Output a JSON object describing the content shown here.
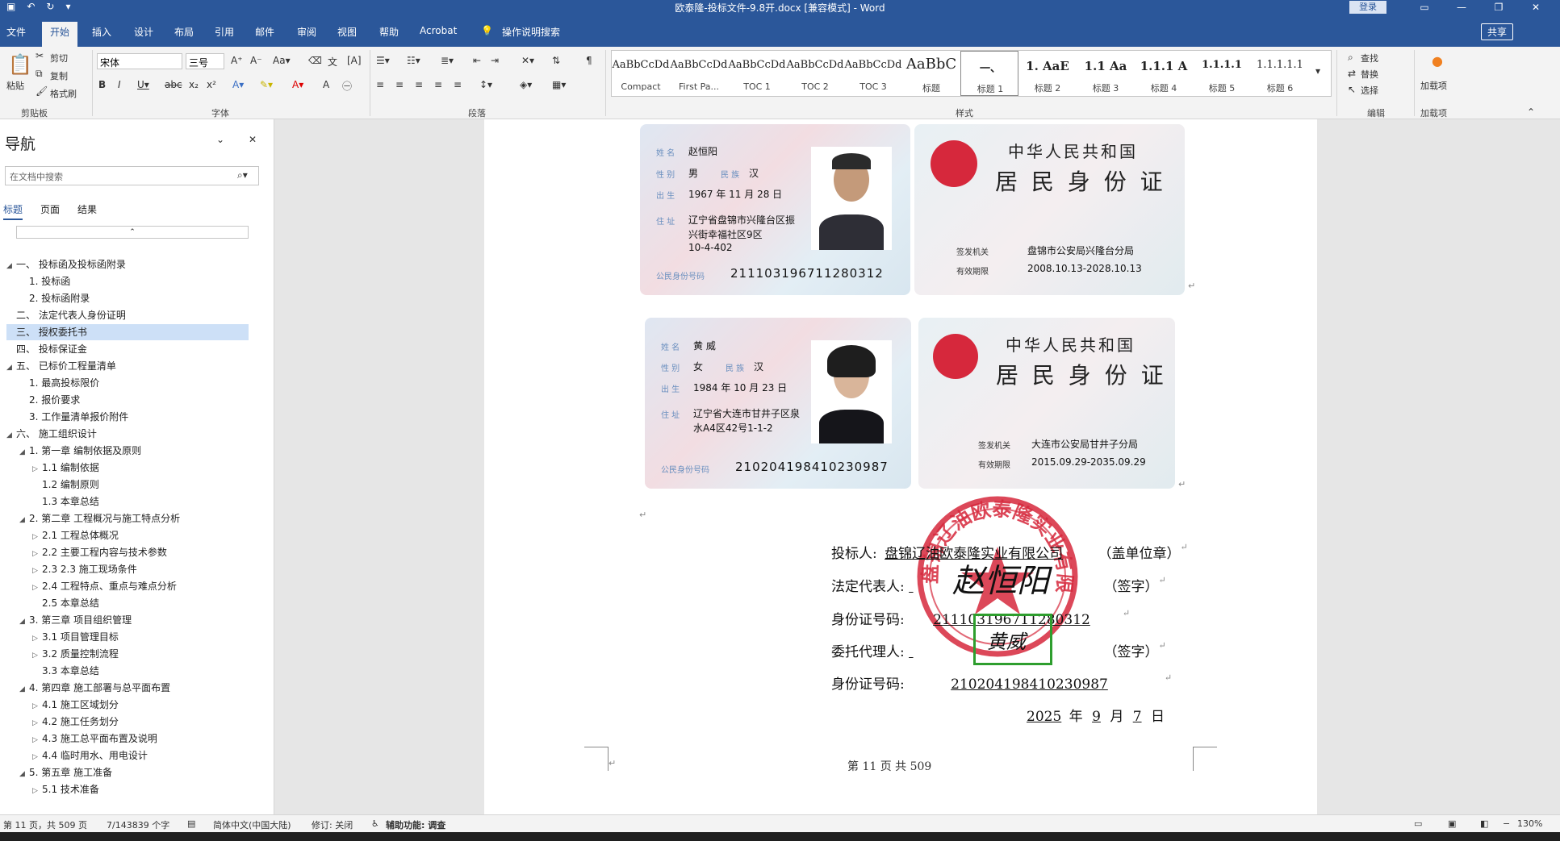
{
  "window": {
    "title": "欧泰隆-投标文件-9.8开.docx [兼容模式] - Word",
    "login": "登录",
    "share": "共享"
  },
  "tabs": [
    "文件",
    "开始",
    "插入",
    "设计",
    "布局",
    "引用",
    "邮件",
    "审阅",
    "视图",
    "帮助",
    "Acrobat",
    "操作说明搜索"
  ],
  "ribbon": {
    "clipboard": {
      "paste": "粘贴",
      "cut": "剪切",
      "copy": "复制",
      "format_painter": "格式刷",
      "label": "剪贴板"
    },
    "font": {
      "name": "宋体",
      "size": "三号",
      "label": "字体"
    },
    "paragraph": {
      "label": "段落"
    },
    "styles": {
      "label": "样式",
      "items": [
        {
          "sample": "AaBbCcDd",
          "name": "Compact"
        },
        {
          "sample": "AaBbCcDd",
          "name": "First Pa..."
        },
        {
          "sample": "AaBbCcDd",
          "name": "TOC 1"
        },
        {
          "sample": "AaBbCcDd",
          "name": "TOC 2"
        },
        {
          "sample": "AaBbCcDd",
          "name": "TOC 3"
        },
        {
          "sample": "AaBbC",
          "name": "标题"
        },
        {
          "sample": "一、",
          "name": "标题 1"
        },
        {
          "sample": "1. AaE",
          "name": "标题 2"
        },
        {
          "sample": "1.1 Aa",
          "name": "标题 3"
        },
        {
          "sample": "1.1.1 A",
          "name": "标题 4"
        },
        {
          "sample": "1.1.1.1",
          "name": "标题 5"
        },
        {
          "sample": "1.1.1.1.1",
          "name": "标题 6"
        }
      ]
    },
    "editing": {
      "find": "查找",
      "replace": "替换",
      "select": "选择",
      "label": "编辑"
    },
    "addins": {
      "addin": "加载项",
      "label": "加载项"
    }
  },
  "nav": {
    "title": "导航",
    "search_placeholder": "在文档中搜索",
    "tabs": [
      "标题",
      "页面",
      "结果"
    ],
    "items": [
      {
        "text": "一、 投标函及投标函附录",
        "level": 0,
        "toggle": "◢"
      },
      {
        "text": "1. 投标函",
        "level": 1,
        "toggle": ""
      },
      {
        "text": "2. 投标函附录",
        "level": 1,
        "toggle": ""
      },
      {
        "text": "二、 法定代表人身份证明",
        "level": 0,
        "toggle": ""
      },
      {
        "text": "三、 授权委托书",
        "level": 0,
        "toggle": "",
        "selected": true
      },
      {
        "text": "四、 投标保证金",
        "level": 0,
        "toggle": ""
      },
      {
        "text": "五、 已标价工程量清单",
        "level": 0,
        "toggle": "◢"
      },
      {
        "text": "1. 最高投标限价",
        "level": 1,
        "toggle": ""
      },
      {
        "text": "2. 报价要求",
        "level": 1,
        "toggle": ""
      },
      {
        "text": "3. 工作量清单报价附件",
        "level": 1,
        "toggle": ""
      },
      {
        "text": "六、 施工组织设计",
        "level": 0,
        "toggle": "◢"
      },
      {
        "text": "1. 第一章 编制依据及原则",
        "level": 1,
        "toggle": "◢"
      },
      {
        "text": "1.1 编制依据",
        "level": 2,
        "toggle": "▷"
      },
      {
        "text": "1.2 编制原则",
        "level": 2,
        "toggle": ""
      },
      {
        "text": "1.3 本章总结",
        "level": 2,
        "toggle": ""
      },
      {
        "text": "2. 第二章 工程概况与施工特点分析",
        "level": 1,
        "toggle": "◢"
      },
      {
        "text": "2.1 工程总体概况",
        "level": 2,
        "toggle": "▷"
      },
      {
        "text": "2.2 主要工程内容与技术参数",
        "level": 2,
        "toggle": "▷"
      },
      {
        "text": "2.3 2.3 施工现场条件",
        "level": 2,
        "toggle": "▷"
      },
      {
        "text": "2.4 工程特点、重点与难点分析",
        "level": 2,
        "toggle": "▷"
      },
      {
        "text": "2.5 本章总结",
        "level": 2,
        "toggle": ""
      },
      {
        "text": "3. 第三章 项目组织管理",
        "level": 1,
        "toggle": "◢"
      },
      {
        "text": "3.1 项目管理目标",
        "level": 2,
        "toggle": "▷"
      },
      {
        "text": "3.2 质量控制流程",
        "level": 2,
        "toggle": "▷"
      },
      {
        "text": "3.3 本章总结",
        "level": 2,
        "toggle": ""
      },
      {
        "text": "4. 第四章 施工部署与总平面布置",
        "level": 1,
        "toggle": "◢"
      },
      {
        "text": "4.1 施工区域划分",
        "level": 2,
        "toggle": "▷"
      },
      {
        "text": "4.2 施工任务划分",
        "level": 2,
        "toggle": "▷"
      },
      {
        "text": "4.3 施工总平面布置及说明",
        "level": 2,
        "toggle": "▷"
      },
      {
        "text": "4.4 临时用水、用电设计",
        "level": 2,
        "toggle": "▷"
      },
      {
        "text": "5. 第五章 施工准备",
        "level": 1,
        "toggle": "◢"
      },
      {
        "text": "5.1 技术准备",
        "level": 2,
        "toggle": "▷"
      }
    ]
  },
  "doc": {
    "card1": {
      "name_lbl": "姓 名",
      "name": "赵恒阳",
      "sex_lbl": "性 别",
      "sex": "男",
      "eth_lbl": "民 族",
      "eth": "汉",
      "birth_lbl": "出 生",
      "birth": "1967 年 11 月 28 日",
      "addr_lbl": "住 址",
      "addr1": "辽宁省盘锦市兴隆台区振",
      "addr2": "兴街幸福社区9区",
      "addr3": "10-4-402",
      "id_lbl": "公民身份号码",
      "id": "211103196711280312"
    },
    "card1b": {
      "t1": "中华人民共和国",
      "t2": "居 民 身 份 证",
      "iss_lbl": "签发机关",
      "iss": "盘锦市公安局兴隆台分局",
      "valid_lbl": "有效期限",
      "valid": "2008.10.13-2028.10.13"
    },
    "card2": {
      "name_lbl": "姓 名",
      "name": "黄 威",
      "sex_lbl": "性 别",
      "sex": "女",
      "eth_lbl": "民 族",
      "eth": "汉",
      "birth_lbl": "出 生",
      "birth": "1984 年 10 月 23 日",
      "addr_lbl": "住 址",
      "addr1": "辽宁省大连市甘井子区泉",
      "addr2": "水A4区42号1-1-2",
      "id_lbl": "公民身份号码",
      "id": "210204198410230987"
    },
    "card2b": {
      "t1": "中华人民共和国",
      "t2": "居 民 身 份 证",
      "iss_lbl": "签发机关",
      "iss": "大连市公安局甘井子分局",
      "valid_lbl": "有效期限",
      "valid": "2015.09.29-2035.09.29"
    },
    "sign": {
      "bidder_lbl": "投标人:",
      "bidder": "盘锦辽油欧泰隆实业有限公司",
      "bidder_note": "（盖单位章）",
      "legal_lbl": "法定代表人:",
      "legal_note": "（签字）",
      "legal_id_lbl": "身份证号码:",
      "legal_id": "211103196711280312",
      "agent_lbl": "委托代理人:",
      "agent_note": "（签字）",
      "agent_id_lbl": "身份证号码:",
      "agent_id": "210204198410230987",
      "year": "2025",
      "year_u": "年",
      "month": "9",
      "month_u": "月",
      "day": "7",
      "day_u": "日",
      "sig_legal": "赵恒阳",
      "sig_agent": "黄威",
      "stamp_text": "盘锦辽油欧泰隆实业有限公司"
    },
    "footer": "第 11 页 共 509"
  },
  "status": {
    "page": "第 11 页，共 509 页",
    "words": "7/143839 个字",
    "lang": "简体中文(中国大陆)",
    "track": "修订: 关闭",
    "access": "辅助功能: 调查",
    "zoom": "130%"
  },
  "colors": {
    "accent": "#2b579a",
    "seal": "#d6283c",
    "highlight": "#2e9e2e"
  }
}
